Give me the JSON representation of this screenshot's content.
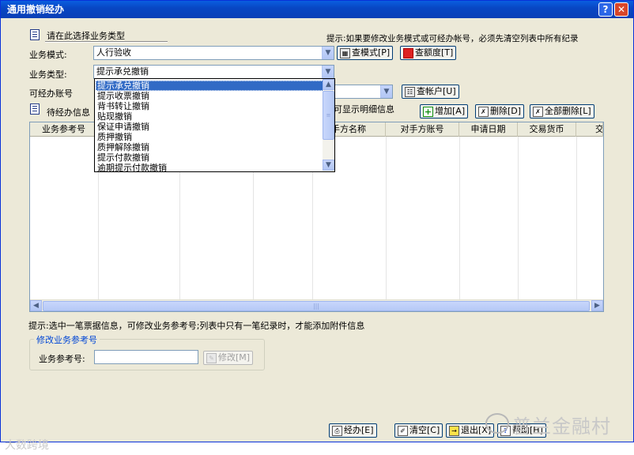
{
  "window": {
    "title": "通用撤销经办",
    "help_icon": "?",
    "close_icon": "✕"
  },
  "section": {
    "choose_label": "请在此选择业务类型"
  },
  "hint_top": "提示:如果要修改业务模式或可经办帐号，必须先清空列表中所有纪录",
  "mode": {
    "label": "业务模式:",
    "value": "人行验收",
    "btn_mode": "查模式[P]",
    "btn_quota": "查额度[T]"
  },
  "type": {
    "label": "业务类型:",
    "value": "提示承兑撤销"
  },
  "account": {
    "label": "可经办账号",
    "btn_query": "查帐户[U]"
  },
  "pending": {
    "label": "待经办信息",
    "detail_hint": "可显示明细信息",
    "btn_add": "增加[A]",
    "btn_delete": "删除[D]",
    "btn_delete_all": "全部删除[L]"
  },
  "dropdown": {
    "items": [
      "提示承兑撤销",
      "提示收票撤销",
      "背书转让撤销",
      "贴现撤销",
      "保证申请撤销",
      "质押撤销",
      "质押解除撤销",
      "提示付款撤销",
      "逾期提示付款撤销"
    ],
    "selected": "提示承兑撤销"
  },
  "table": {
    "columns": [
      "业务参考号",
      "",
      "",
      "",
      "手方名称",
      "对手方账号",
      "申请日期",
      "交易货币",
      "交"
    ]
  },
  "hint_bottom": "提示:选中一笔票据信息，可修改业务参考号;列表中只有一笔纪录时，才能添加附件信息",
  "modify_group": {
    "title": "修改业务参考号",
    "field_label": "业务参考号:",
    "btn_modify": "修改[M]"
  },
  "footer": {
    "btn_handle": "经办[E]",
    "btn_clear": "清空[C]",
    "btn_exit": "退出[X]",
    "btn_help": "帮助[H]"
  },
  "watermark": {
    "brand": "普兰金融村",
    "corner": "大数跨境"
  }
}
